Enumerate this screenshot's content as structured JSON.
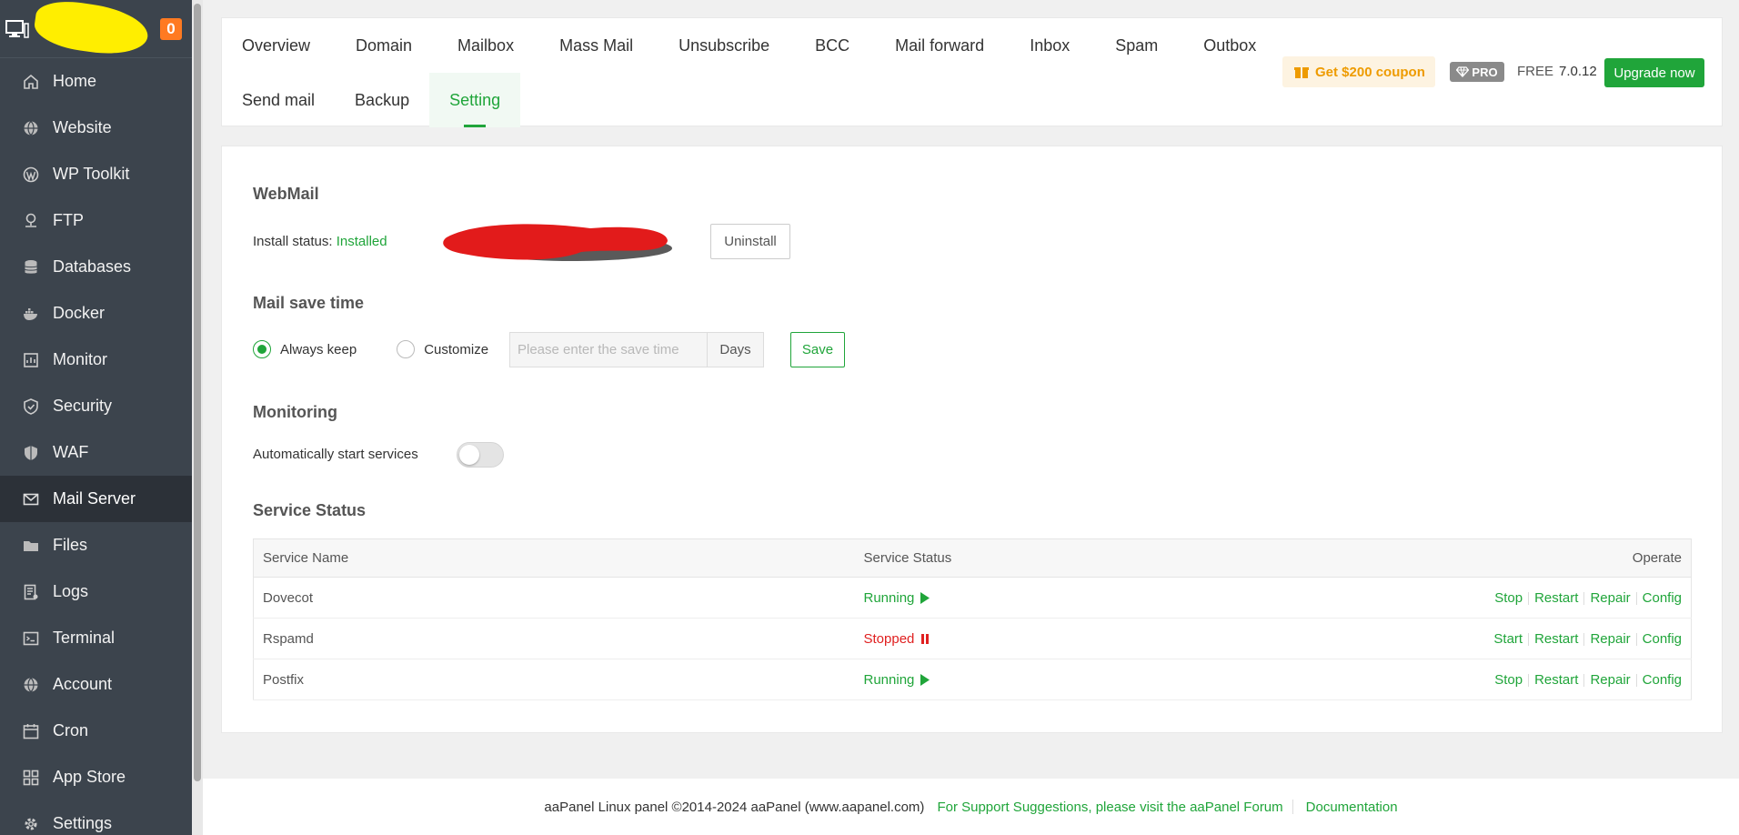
{
  "sidebar": {
    "badge_count": "0",
    "items": [
      {
        "label": "Home",
        "icon": "home-icon"
      },
      {
        "label": "Website",
        "icon": "globe-icon"
      },
      {
        "label": "WP Toolkit",
        "icon": "wordpress-icon"
      },
      {
        "label": "FTP",
        "icon": "ftp-icon"
      },
      {
        "label": "Databases",
        "icon": "database-icon"
      },
      {
        "label": "Docker",
        "icon": "docker-icon"
      },
      {
        "label": "Monitor",
        "icon": "monitor-icon"
      },
      {
        "label": "Security",
        "icon": "shield-icon"
      },
      {
        "label": "WAF",
        "icon": "waf-shield-icon"
      },
      {
        "label": "Mail Server",
        "icon": "mail-icon"
      },
      {
        "label": "Files",
        "icon": "folder-icon"
      },
      {
        "label": "Logs",
        "icon": "logs-icon"
      },
      {
        "label": "Terminal",
        "icon": "terminal-icon"
      },
      {
        "label": "Account",
        "icon": "account-icon"
      },
      {
        "label": "Cron",
        "icon": "calendar-icon"
      },
      {
        "label": "App Store",
        "icon": "apps-icon"
      },
      {
        "label": "Settings",
        "icon": "gear-icon"
      }
    ]
  },
  "tabs": {
    "row1": [
      "Overview",
      "Domain",
      "Mailbox",
      "Mass Mail",
      "Unsubscribe",
      "BCC",
      "Mail forward",
      "Inbox",
      "Spam",
      "Outbox"
    ],
    "row2": [
      "Send mail",
      "Backup",
      "Setting"
    ],
    "active": "Setting"
  },
  "header": {
    "coupon": "Get $200 coupon",
    "pro": "PRO",
    "free": "FREE",
    "version": "7.0.12",
    "upgrade": "Upgrade now"
  },
  "webmail": {
    "title": "WebMail",
    "install_label": "Install status:",
    "install_value": "Installed",
    "uninstall": "Uninstall"
  },
  "save_time": {
    "title": "Mail save time",
    "always_keep": "Always keep",
    "customize": "Customize",
    "placeholder": "Please enter the save time",
    "unit": "Days",
    "save": "Save"
  },
  "monitoring": {
    "title": "Monitoring",
    "auto_start": "Automatically start services"
  },
  "service_status": {
    "title": "Service Status",
    "columns": [
      "Service Name",
      "Service Status",
      "Operate"
    ],
    "rows": [
      {
        "name": "Dovecot",
        "status": "Running",
        "ops": [
          "Stop",
          "Restart",
          "Repair",
          "Config"
        ]
      },
      {
        "name": "Rspamd",
        "status": "Stopped",
        "ops": [
          "Start",
          "Restart",
          "Repair",
          "Config"
        ]
      },
      {
        "name": "Postfix",
        "status": "Running",
        "ops": [
          "Stop",
          "Restart",
          "Repair",
          "Config"
        ]
      }
    ]
  },
  "footer": {
    "copyright": "aaPanel Linux panel ©2014-2024 aaPanel (www.aapanel.com)",
    "support": "For Support Suggestions, please visit the aaPanel Forum",
    "docs": "Documentation"
  },
  "colors": {
    "accent": "#20a53a",
    "sidebar_bg": "#3c444d",
    "danger": "#e02020",
    "coupon": "#ee9b00"
  }
}
